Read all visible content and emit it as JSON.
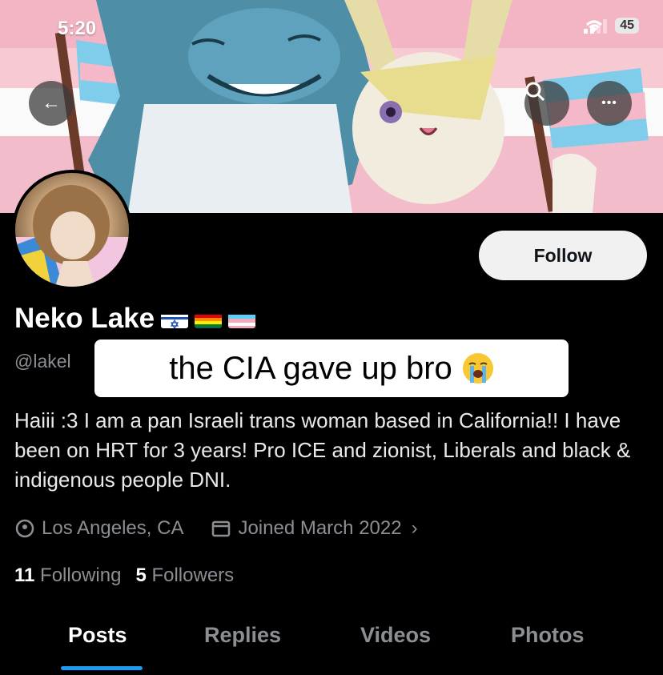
{
  "status_bar": {
    "time": "5:20",
    "battery": "45"
  },
  "header_buttons": {
    "back": "←",
    "search": "⌕",
    "more": "•••"
  },
  "profile": {
    "display_name": "Neko Lake",
    "handle": "@lakel",
    "flags": [
      "israel-flag",
      "rainbow-flag",
      "trans-flag"
    ],
    "follow_label": "Follow",
    "bio": "Haiii :3 I am a pan Israeli trans woman based in California!! I have been on HRT for 3 years! Pro ICE and zionist, Liberals and black & indigenous people DNI.",
    "location": "Los Angeles, CA",
    "joined": "Joined March 2022",
    "following_count": "11",
    "following_label": "Following",
    "followers_count": "5",
    "followers_label": "Followers"
  },
  "overlay_caption": "the CIA gave up bro",
  "tabs": [
    {
      "label": "Posts",
      "active": true
    },
    {
      "label": "Replies",
      "active": false
    },
    {
      "label": "Videos",
      "active": false
    },
    {
      "label": "Photos",
      "active": false
    }
  ],
  "colors": {
    "accent": "#1d9bf0",
    "background": "#000000",
    "muted": "#8b8f93"
  }
}
